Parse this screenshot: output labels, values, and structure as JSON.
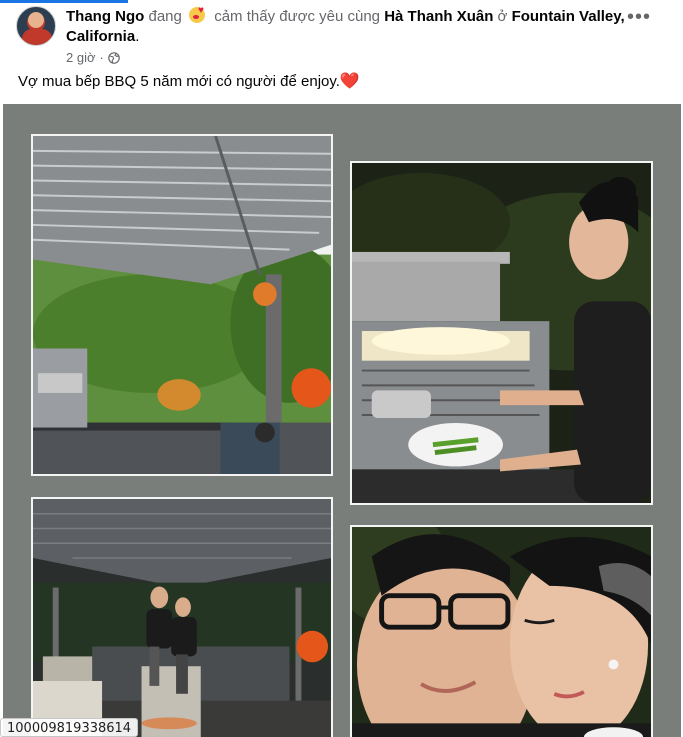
{
  "post": {
    "author": "Thang Ngo",
    "verb_prefix": "đang",
    "feeling_text": "cảm thấy được yêu cùng",
    "tagged_person": "Hà Thanh Xuân",
    "location_prefix": "ở",
    "location": "Fountain Valley, California",
    "period": ".",
    "timestamp": "2 giờ",
    "separator": "·",
    "audience_icon": "globe-icon",
    "feeling_icon": "kissing-face-emoji-icon",
    "more_label": "•••",
    "caption": "Vợ mua bếp BBQ 5 năm mới có người để enjoy.",
    "caption_emoji": "❤️"
  },
  "media": {
    "photos": [
      {
        "subject": "outdoor-kitchen-pergola"
      },
      {
        "subject": "woman-grilling-at-night"
      },
      {
        "subject": "couple-under-pergola"
      },
      {
        "subject": "couple-selfie"
      }
    ]
  },
  "overlay": {
    "id_label": "100009819338614"
  },
  "colors": {
    "accent": "#1b74e4",
    "frame_background": "#7a7e7a",
    "muted_text": "#65676b",
    "heart": "#e41e3f"
  }
}
